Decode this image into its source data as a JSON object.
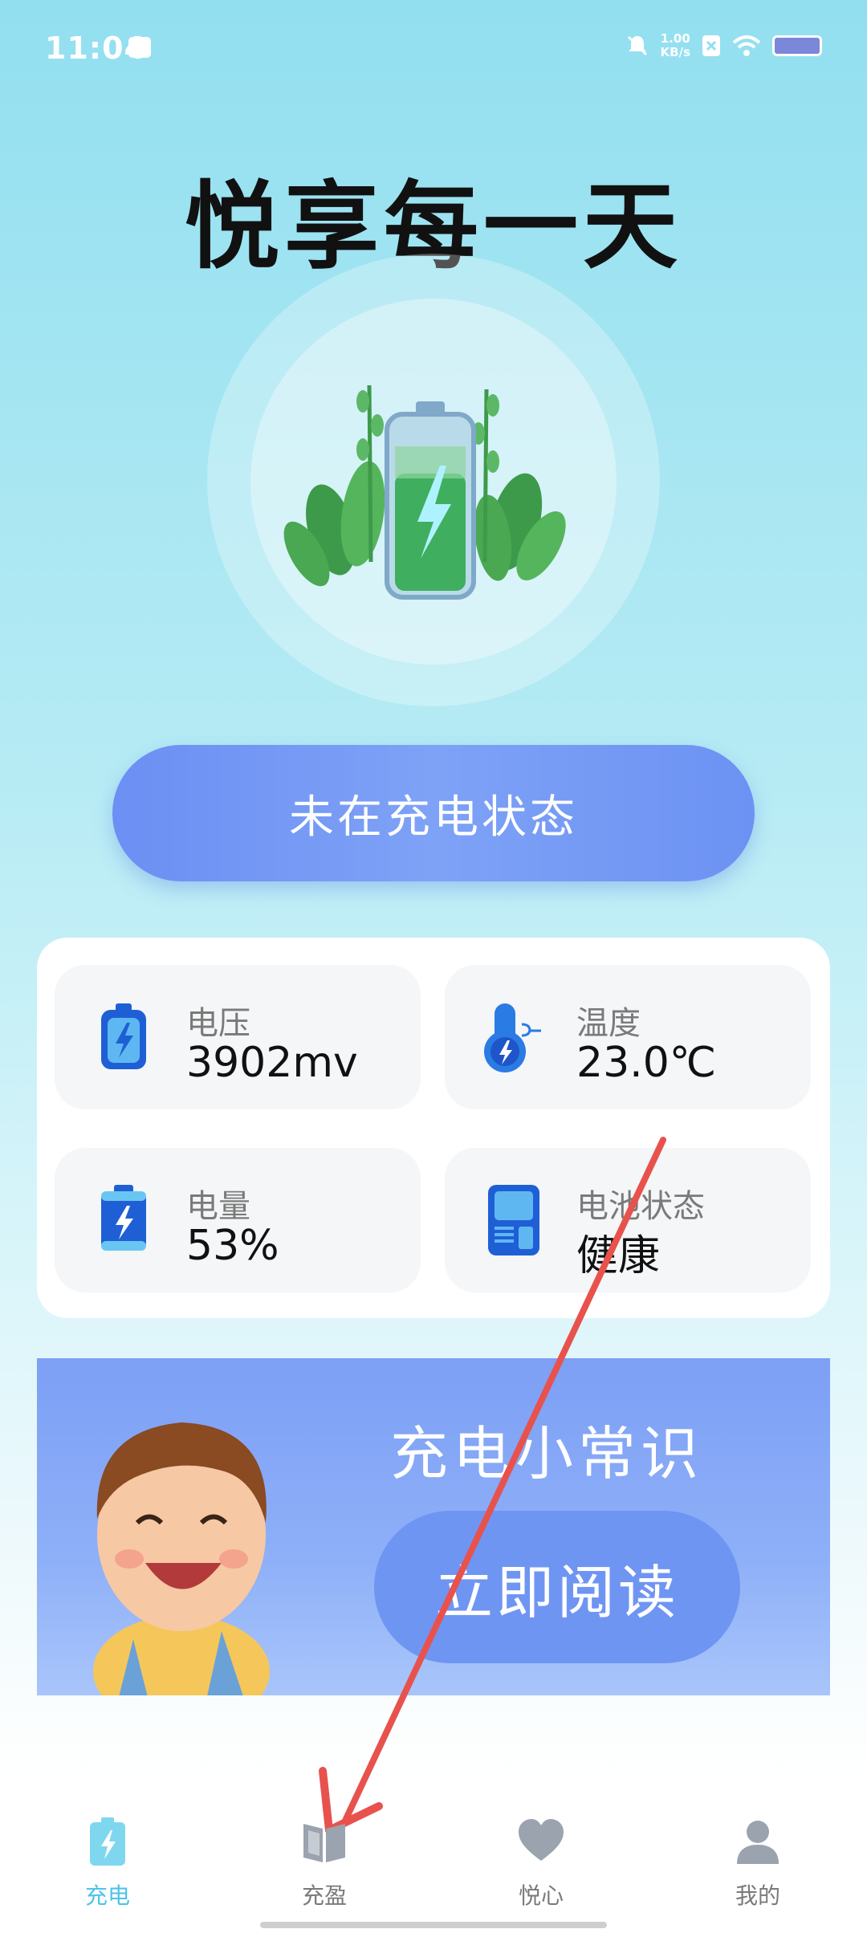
{
  "status_bar": {
    "time": "11:04",
    "speed_value": "1.00",
    "speed_unit": "KB/s"
  },
  "title": "悦享每一天",
  "charging_status": "未在充电状态",
  "stats": [
    {
      "label": "电压",
      "value": "3902mv",
      "icon": "battery-voltage-icon"
    },
    {
      "label": "温度",
      "value": "23.0℃",
      "icon": "thermometer-icon"
    },
    {
      "label": "电量",
      "value": "53%",
      "icon": "battery-level-icon"
    },
    {
      "label": "电池状态",
      "value": "健康",
      "icon": "battery-health-icon"
    }
  ],
  "banner": {
    "title": "充电小常识",
    "button_label": "立即阅读"
  },
  "tabs": [
    {
      "label": "充电",
      "icon": "battery-charge-icon",
      "active": true
    },
    {
      "label": "充盈",
      "icon": "book-icon",
      "active": false
    },
    {
      "label": "悦心",
      "icon": "heart-icon",
      "active": false
    },
    {
      "label": "我的",
      "icon": "user-icon",
      "active": false
    }
  ],
  "colors": {
    "accent": "#6f95f3",
    "active_tab": "#4fc3e8",
    "annotation_arrow": "#e8524d"
  }
}
